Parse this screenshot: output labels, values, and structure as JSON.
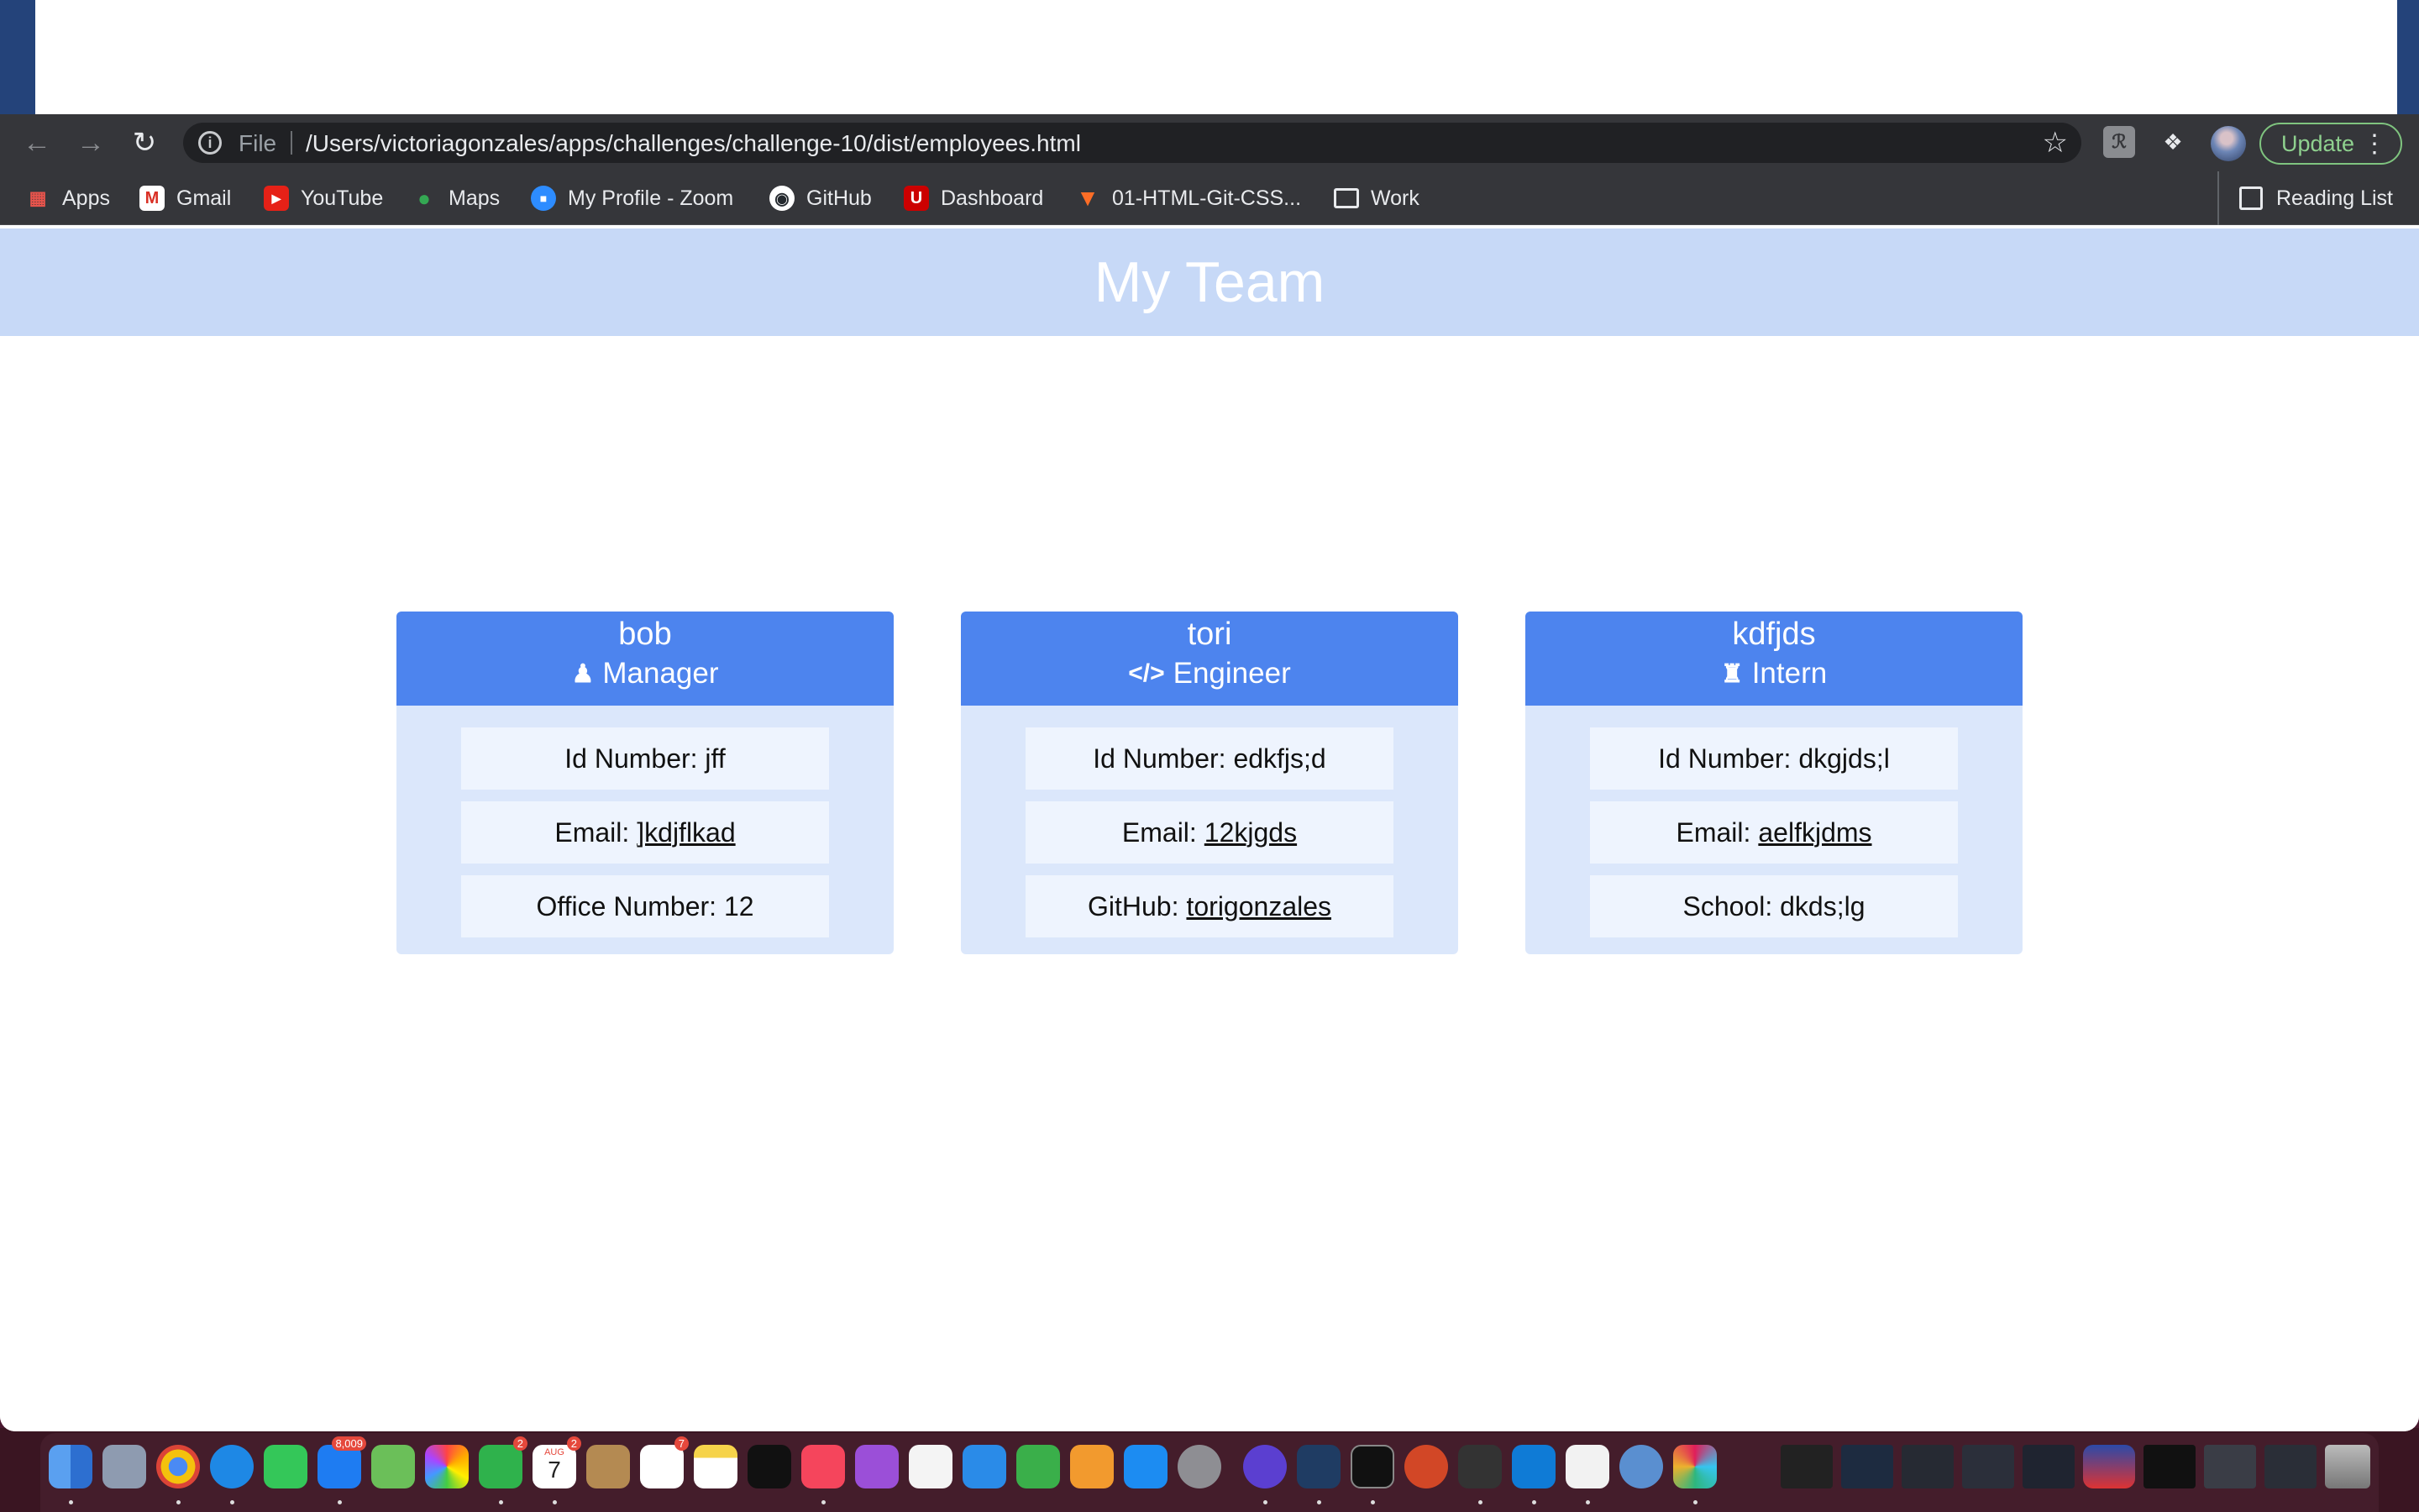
{
  "browser": {
    "address": {
      "scheme_label": "File",
      "url": "/Users/victoriagonzales/apps/challenges/challenge-10/dist/employees.html"
    },
    "update_label": "Update",
    "bookmarks": [
      "Apps",
      "Gmail",
      "YouTube",
      "Maps",
      "My Profile - Zoom",
      "GitHub",
      "Dashboard",
      "01-HTML-Git-CSS...",
      "Work"
    ],
    "reading_list": "Reading List"
  },
  "page": {
    "title": "My Team",
    "cards": [
      {
        "name": "bob",
        "role": "Manager",
        "id_label": "Id Number: jff",
        "email_prefix": "Email:",
        "email": "]kdjflkad",
        "extra_label": "Office Number: 12"
      },
      {
        "name": "tori",
        "role": "Engineer",
        "id_label": "Id Number: edkfjs;d",
        "email_prefix": "Email:",
        "email": "12kjgds",
        "extra_prefix": "GitHub:",
        "extra_link": "torigonzales"
      },
      {
        "name": "kdfjds",
        "role": "Intern",
        "id_label": "Id Number: dkgjds;l",
        "email_prefix": "Email:",
        "email": "aelfkjdms",
        "extra_label": "School: dkds;lg"
      }
    ]
  },
  "dock": {
    "badges": [
      "8,009",
      "2",
      "2",
      "7"
    ],
    "calendar": {
      "month": "AUG",
      "day": "7"
    }
  },
  "colors": {
    "banner": "#c7d9f7",
    "card_header": "#4d84ee",
    "card_body": "#dbe7fb",
    "info_box": "#eef4fe"
  }
}
